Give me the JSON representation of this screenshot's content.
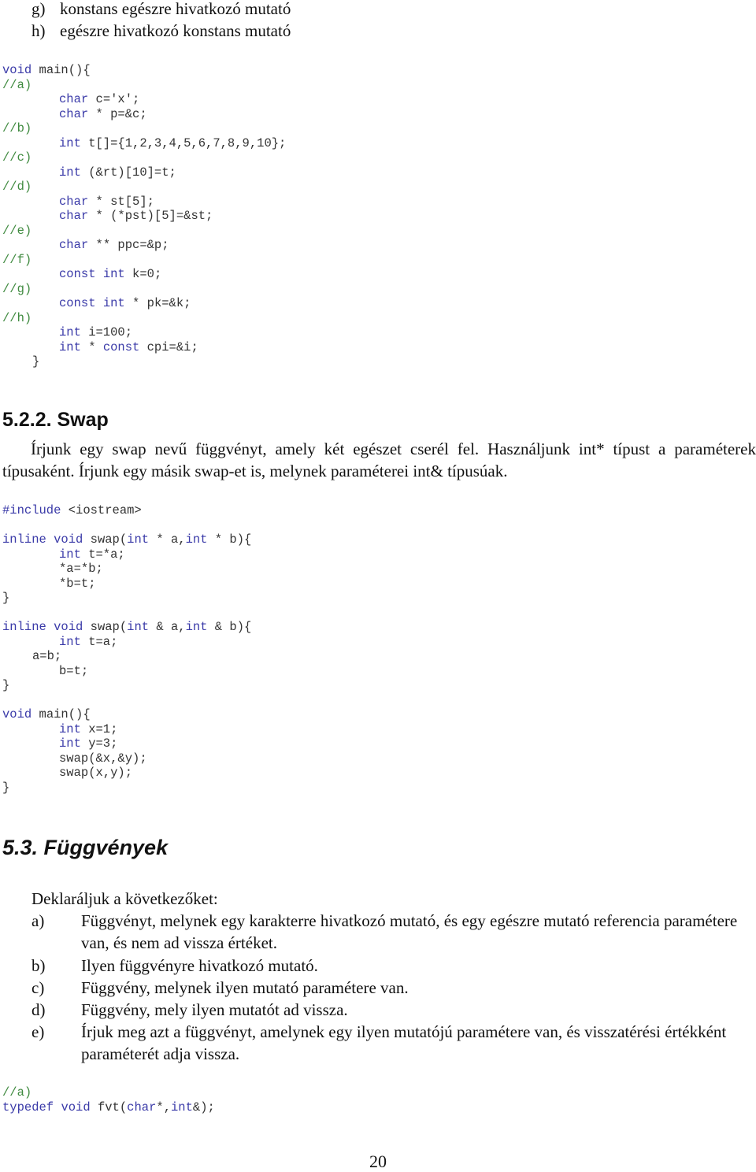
{
  "top_list": [
    {
      "label": "g)",
      "text": "konstans egészre hivatkozó mutató"
    },
    {
      "label": "h)",
      "text": "egészre hivatkozó konstans mutató"
    }
  ],
  "code1": [
    {
      "indent": 0,
      "parts": [
        {
          "t": "void",
          "c": "kw"
        },
        {
          "t": " main(){",
          "c": ""
        }
      ]
    },
    {
      "indent": 0,
      "parts": [
        {
          "t": "//a)",
          "c": "cm"
        }
      ]
    },
    {
      "indent": 2,
      "parts": [
        {
          "t": "char",
          "c": "kw"
        },
        {
          "t": " c='x';",
          "c": ""
        }
      ]
    },
    {
      "indent": 2,
      "parts": [
        {
          "t": "char",
          "c": "kw"
        },
        {
          "t": " * p=&c;",
          "c": ""
        }
      ]
    },
    {
      "indent": 0,
      "parts": [
        {
          "t": "//b)",
          "c": "cm"
        }
      ]
    },
    {
      "indent": 2,
      "parts": [
        {
          "t": "int",
          "c": "kw"
        },
        {
          "t": " t[]={1,2,3,4,5,6,7,8,9,10};",
          "c": ""
        }
      ]
    },
    {
      "indent": 0,
      "parts": [
        {
          "t": "//c)",
          "c": "cm"
        }
      ]
    },
    {
      "indent": 2,
      "parts": [
        {
          "t": "int",
          "c": "kw"
        },
        {
          "t": " (&rt)[10]=t;",
          "c": ""
        }
      ]
    },
    {
      "indent": 0,
      "parts": [
        {
          "t": "//d)",
          "c": "cm"
        }
      ]
    },
    {
      "indent": 2,
      "parts": [
        {
          "t": "char",
          "c": "kw"
        },
        {
          "t": " * st[5];",
          "c": ""
        }
      ]
    },
    {
      "indent": 2,
      "parts": [
        {
          "t": "char",
          "c": "kw"
        },
        {
          "t": " * (*pst)[5]=&st;",
          "c": ""
        }
      ]
    },
    {
      "indent": 0,
      "parts": [
        {
          "t": "//e)",
          "c": "cm"
        }
      ]
    },
    {
      "indent": 2,
      "parts": [
        {
          "t": "char",
          "c": "kw"
        },
        {
          "t": " ** ppc=&p;",
          "c": ""
        }
      ]
    },
    {
      "indent": 0,
      "parts": [
        {
          "t": "//f)",
          "c": "cm"
        }
      ]
    },
    {
      "indent": 2,
      "parts": [
        {
          "t": "const",
          "c": "kw"
        },
        {
          "t": " ",
          "c": ""
        },
        {
          "t": "int",
          "c": "kw"
        },
        {
          "t": " k=0;",
          "c": ""
        }
      ]
    },
    {
      "indent": 0,
      "parts": [
        {
          "t": "//g)",
          "c": "cm"
        }
      ]
    },
    {
      "indent": 2,
      "parts": [
        {
          "t": "const",
          "c": "kw"
        },
        {
          "t": " ",
          "c": ""
        },
        {
          "t": "int",
          "c": "kw"
        },
        {
          "t": " * pk=&k;",
          "c": ""
        }
      ]
    },
    {
      "indent": 0,
      "parts": [
        {
          "t": "//h)",
          "c": "cm"
        }
      ]
    },
    {
      "indent": 2,
      "parts": [
        {
          "t": "int",
          "c": "kw"
        },
        {
          "t": " i=100;",
          "c": ""
        }
      ]
    },
    {
      "indent": 2,
      "parts": [
        {
          "t": "int",
          "c": "kw"
        },
        {
          "t": " * ",
          "c": ""
        },
        {
          "t": "const",
          "c": "kw"
        },
        {
          "t": " cpi=&i;",
          "c": ""
        }
      ]
    },
    {
      "indent": 1,
      "parts": [
        {
          "t": "}",
          "c": ""
        }
      ]
    }
  ],
  "section_swap": {
    "heading": "5.2.2. Swap",
    "paragraph": "Írjunk egy swap nevű függvényt, amely két egészet cserél fel. Használjunk int* típust a paraméterek típusaként. Írjunk egy másik swap-et is, melynek paraméterei int& típusúak."
  },
  "code2": [
    {
      "indent": 0,
      "parts": [
        {
          "t": "#include",
          "c": "pp"
        },
        {
          "t": " <iostream>",
          "c": ""
        }
      ]
    },
    {
      "indent": 0,
      "parts": []
    },
    {
      "indent": 0,
      "parts": [
        {
          "t": "inline",
          "c": "kw"
        },
        {
          "t": " ",
          "c": ""
        },
        {
          "t": "void",
          "c": "kw"
        },
        {
          "t": " swap(",
          "c": ""
        },
        {
          "t": "int",
          "c": "kw"
        },
        {
          "t": " * a,",
          "c": ""
        },
        {
          "t": "int",
          "c": "kw"
        },
        {
          "t": " * b){",
          "c": ""
        }
      ]
    },
    {
      "indent": 2,
      "parts": [
        {
          "t": "int",
          "c": "kw"
        },
        {
          "t": " t=*a;",
          "c": ""
        }
      ]
    },
    {
      "indent": 2,
      "parts": [
        {
          "t": "*a=*b;",
          "c": ""
        }
      ]
    },
    {
      "indent": 2,
      "parts": [
        {
          "t": "*b=t;",
          "c": ""
        }
      ]
    },
    {
      "indent": 0,
      "parts": [
        {
          "t": "}",
          "c": ""
        }
      ]
    },
    {
      "indent": 0,
      "parts": []
    },
    {
      "indent": 0,
      "parts": [
        {
          "t": "inline",
          "c": "kw"
        },
        {
          "t": " ",
          "c": ""
        },
        {
          "t": "void",
          "c": "kw"
        },
        {
          "t": " swap(",
          "c": ""
        },
        {
          "t": "int",
          "c": "kw"
        },
        {
          "t": " & a,",
          "c": ""
        },
        {
          "t": "int",
          "c": "kw"
        },
        {
          "t": " & b){",
          "c": ""
        }
      ]
    },
    {
      "indent": 2,
      "parts": [
        {
          "t": "int",
          "c": "kw"
        },
        {
          "t": " t=a;",
          "c": ""
        }
      ]
    },
    {
      "indent": 1,
      "parts": [
        {
          "t": "a=b;",
          "c": ""
        }
      ]
    },
    {
      "indent": 2,
      "parts": [
        {
          "t": "b=t;",
          "c": ""
        }
      ]
    },
    {
      "indent": 0,
      "parts": [
        {
          "t": "}",
          "c": ""
        }
      ]
    },
    {
      "indent": 0,
      "parts": []
    },
    {
      "indent": 0,
      "parts": [
        {
          "t": "void",
          "c": "kw"
        },
        {
          "t": " main(){",
          "c": ""
        }
      ]
    },
    {
      "indent": 2,
      "parts": [
        {
          "t": "int",
          "c": "kw"
        },
        {
          "t": " x=1;",
          "c": ""
        }
      ]
    },
    {
      "indent": 2,
      "parts": [
        {
          "t": "int",
          "c": "kw"
        },
        {
          "t": " y=3;",
          "c": ""
        }
      ]
    },
    {
      "indent": 2,
      "parts": [
        {
          "t": "swap(&x,&y);",
          "c": ""
        }
      ]
    },
    {
      "indent": 2,
      "parts": [
        {
          "t": "swap(x,y);",
          "c": ""
        }
      ]
    },
    {
      "indent": 0,
      "parts": [
        {
          "t": "}",
          "c": ""
        }
      ]
    }
  ],
  "section_functions": {
    "heading": "5.3. Függvények",
    "intro": "Deklaráljuk a következőket:",
    "items": [
      {
        "label": "a)",
        "text": "Függvényt, melynek egy karakterre hivatkozó mutató, és egy egészre mutató referencia paramétere van, és nem ad vissza értéket."
      },
      {
        "label": "b)",
        "text": "Ilyen függvényre hivatkozó mutató."
      },
      {
        "label": "c)",
        "text": "Függvény, melynek ilyen mutató paramétere van."
      },
      {
        "label": "d)",
        "text": "Függvény, mely ilyen mutatót ad vissza."
      },
      {
        "label": "e)",
        "text": "Írjuk meg azt a függvényt, amelynek egy ilyen mutatójú paramétere van, és visszatérési értékként paraméterét adja vissza."
      }
    ]
  },
  "code3": [
    {
      "indent": 0,
      "parts": [
        {
          "t": "//a)",
          "c": "cm"
        }
      ]
    },
    {
      "indent": 0,
      "parts": [
        {
          "t": "typedef",
          "c": "kw"
        },
        {
          "t": " ",
          "c": ""
        },
        {
          "t": "void",
          "c": "kw"
        },
        {
          "t": " fvt(",
          "c": ""
        },
        {
          "t": "char",
          "c": "kw"
        },
        {
          "t": "*,",
          "c": ""
        },
        {
          "t": "int",
          "c": "kw"
        },
        {
          "t": "&);",
          "c": ""
        }
      ]
    }
  ],
  "page_number": "20",
  "colors": {
    "keyword": "#3a3aa8",
    "comment": "#3f8a3f",
    "text": "#333333"
  }
}
